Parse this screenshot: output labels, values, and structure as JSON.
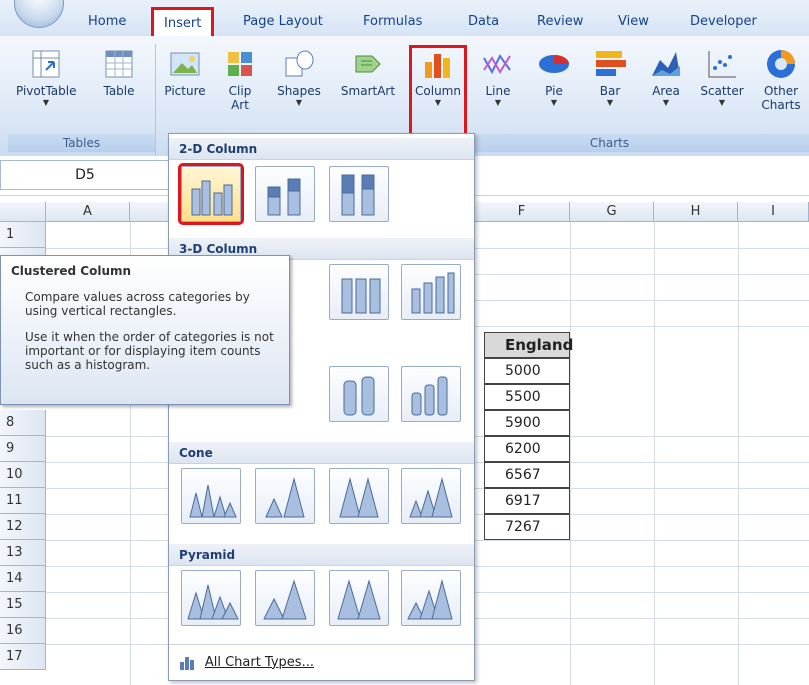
{
  "tabs": [
    "Home",
    "Insert",
    "Page Layout",
    "Formulas",
    "Data",
    "Review",
    "View",
    "Developer"
  ],
  "ribbon": {
    "tables_group": "Tables",
    "charts_group": "Charts",
    "buttons": {
      "pivottable": "PivotTable",
      "table": "Table",
      "picture": "Picture",
      "clipart_1": "Clip",
      "clipart_2": "Art",
      "shapes": "Shapes",
      "smartart": "SmartArt",
      "column": "Column",
      "line": "Line",
      "pie": "Pie",
      "bar": "Bar",
      "area": "Area",
      "scatter": "Scatter",
      "other_1": "Other",
      "other_2": "Charts"
    }
  },
  "namebox": "D5",
  "columns": [
    "A",
    "F",
    "G",
    "H",
    "I"
  ],
  "rows": [
    "1",
    "8",
    "9",
    "10",
    "11",
    "12",
    "13",
    "14",
    "15",
    "16",
    "17"
  ],
  "table": {
    "header": "England",
    "values": [
      "5000",
      "5500",
      "5900",
      "6200",
      "6567",
      "6917",
      "7267"
    ]
  },
  "dropdown": {
    "sections": [
      "2-D Column",
      "3-D Column",
      "Cone",
      "Pyramid"
    ],
    "footer": "All Chart Types..."
  },
  "tooltip": {
    "title": "Clustered Column",
    "p1": "Compare values across categories by using vertical rectangles.",
    "p2": "Use it when the order of categories is not important or for displaying item counts such as a histogram."
  },
  "colors": {
    "highlight": "#e0161e",
    "ribbon": "#dbe7f6",
    "tab_text": "#15428b"
  }
}
